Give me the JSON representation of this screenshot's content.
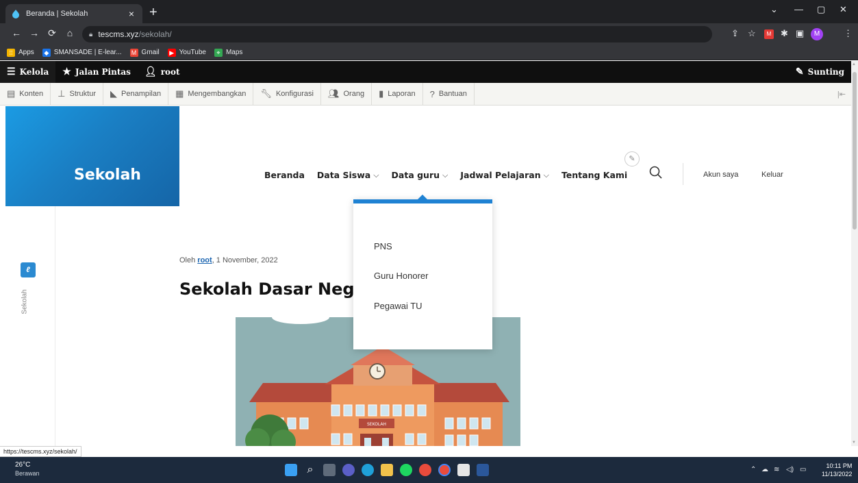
{
  "browser": {
    "tab_title": "Beranda | Sekolah",
    "tab_close": "×",
    "new_tab": "+",
    "url_host": "tescms.xyz",
    "url_path": "/sekolah/",
    "bookmarks": [
      {
        "label": "Apps",
        "icon": "apps-grid-icon",
        "color": "#f4b400"
      },
      {
        "label": "SMANSADE | E-lear...",
        "icon": "school-icon",
        "color": "#1a73e8"
      },
      {
        "label": "Gmail",
        "icon": "gmail-icon",
        "color": "#ea4335"
      },
      {
        "label": "YouTube",
        "icon": "youtube-icon",
        "color": "#ff0000"
      },
      {
        "label": "Maps",
        "icon": "maps-icon",
        "color": "#34a853"
      }
    ],
    "profile_initial": "M",
    "status_url": "https://tescms.xyz/sekolah/"
  },
  "admin_toolbar": {
    "kelola": "Kelola",
    "jalan_pintas": "Jalan Pintas",
    "user": "root",
    "sunting": "Sunting"
  },
  "admin_tray": [
    {
      "label": "Konten",
      "icon": "content-icon"
    },
    {
      "label": "Struktur",
      "icon": "structure-icon"
    },
    {
      "label": "Penampilan",
      "icon": "appearance-icon"
    },
    {
      "label": "Mengembangkan",
      "icon": "extend-icon"
    },
    {
      "label": "Konfigurasi",
      "icon": "wrench-icon"
    },
    {
      "label": "Orang",
      "icon": "people-icon"
    },
    {
      "label": "Laporan",
      "icon": "reports-icon"
    },
    {
      "label": "Bantuan",
      "icon": "help-icon"
    }
  ],
  "site": {
    "name": "Sekolah",
    "sidebar_label": "Sekolah",
    "nav": [
      {
        "label": "Beranda",
        "has_submenu": false
      },
      {
        "label": "Data Siswa",
        "has_submenu": true
      },
      {
        "label": "Data guru",
        "has_submenu": true
      },
      {
        "label": "Jadwal Pelajaran",
        "has_submenu": true
      },
      {
        "label": "Tentang Kami",
        "has_submenu": false
      }
    ],
    "chevron": "⌵",
    "account": "Akun saya",
    "logout": "Keluar",
    "dropdown": [
      "PNS",
      "Guru Honorer",
      "Pegawai TU"
    ],
    "accent_color": "#1f82d3"
  },
  "article": {
    "meta_prefix": "Oleh ",
    "author": "root",
    "meta_date": ", 1 November, 2022",
    "title": "Sekolah Dasar Negeri"
  },
  "illustration": {
    "sign": "SEKOLAH"
  },
  "taskbar": {
    "temperature": "26°C",
    "condition": "Berawan",
    "time": "10:11 PM",
    "date": "11/13/2022"
  }
}
